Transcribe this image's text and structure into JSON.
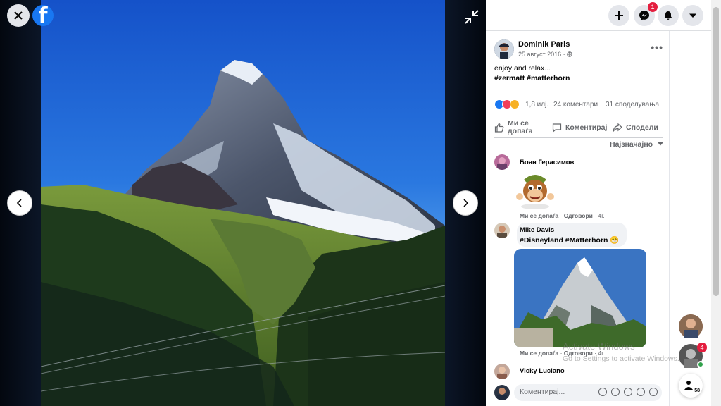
{
  "viewer": {
    "close_icon": "close-icon",
    "logo_letter": "f",
    "prev_icon": "chevron-left-icon",
    "next_icon": "chevron-right-icon",
    "collapse_icon": "collapse-icon"
  },
  "topbar": {
    "messenger_badge": "1"
  },
  "post": {
    "author": "Dominik Paris",
    "date": "25 август 2016 · ",
    "caption": "enjoy and relax...",
    "hashtags": "#zermatt #matterhorn",
    "likes": "1,8 илј.",
    "comments_count": "24 коментари",
    "shares_count": "31 споделувања",
    "actions": {
      "like": "Ми се допаѓа",
      "comment": "Коментирај",
      "share": "Сподели"
    },
    "sort_label": "Најзначајно"
  },
  "comments": [
    {
      "name": "Боян Герасимов",
      "like_label": "Ми се допаѓа",
      "reply_label": "Одговори",
      "time": "4г."
    },
    {
      "name": "Mike Davis",
      "text": "#Disneyland #Matterhorn 😁",
      "like_label": "Ми се допаѓа",
      "reply_label": "Одговори",
      "time": "4г."
    },
    {
      "name": "Vicky Luciano"
    }
  ],
  "comment_box": {
    "placeholder": "Коментирај..."
  },
  "floating": {
    "chat_badge": "4",
    "count_label": "58"
  },
  "watermark": {
    "title": "Activate Windows",
    "subtitle": "Go to Settings to activate Windows."
  }
}
